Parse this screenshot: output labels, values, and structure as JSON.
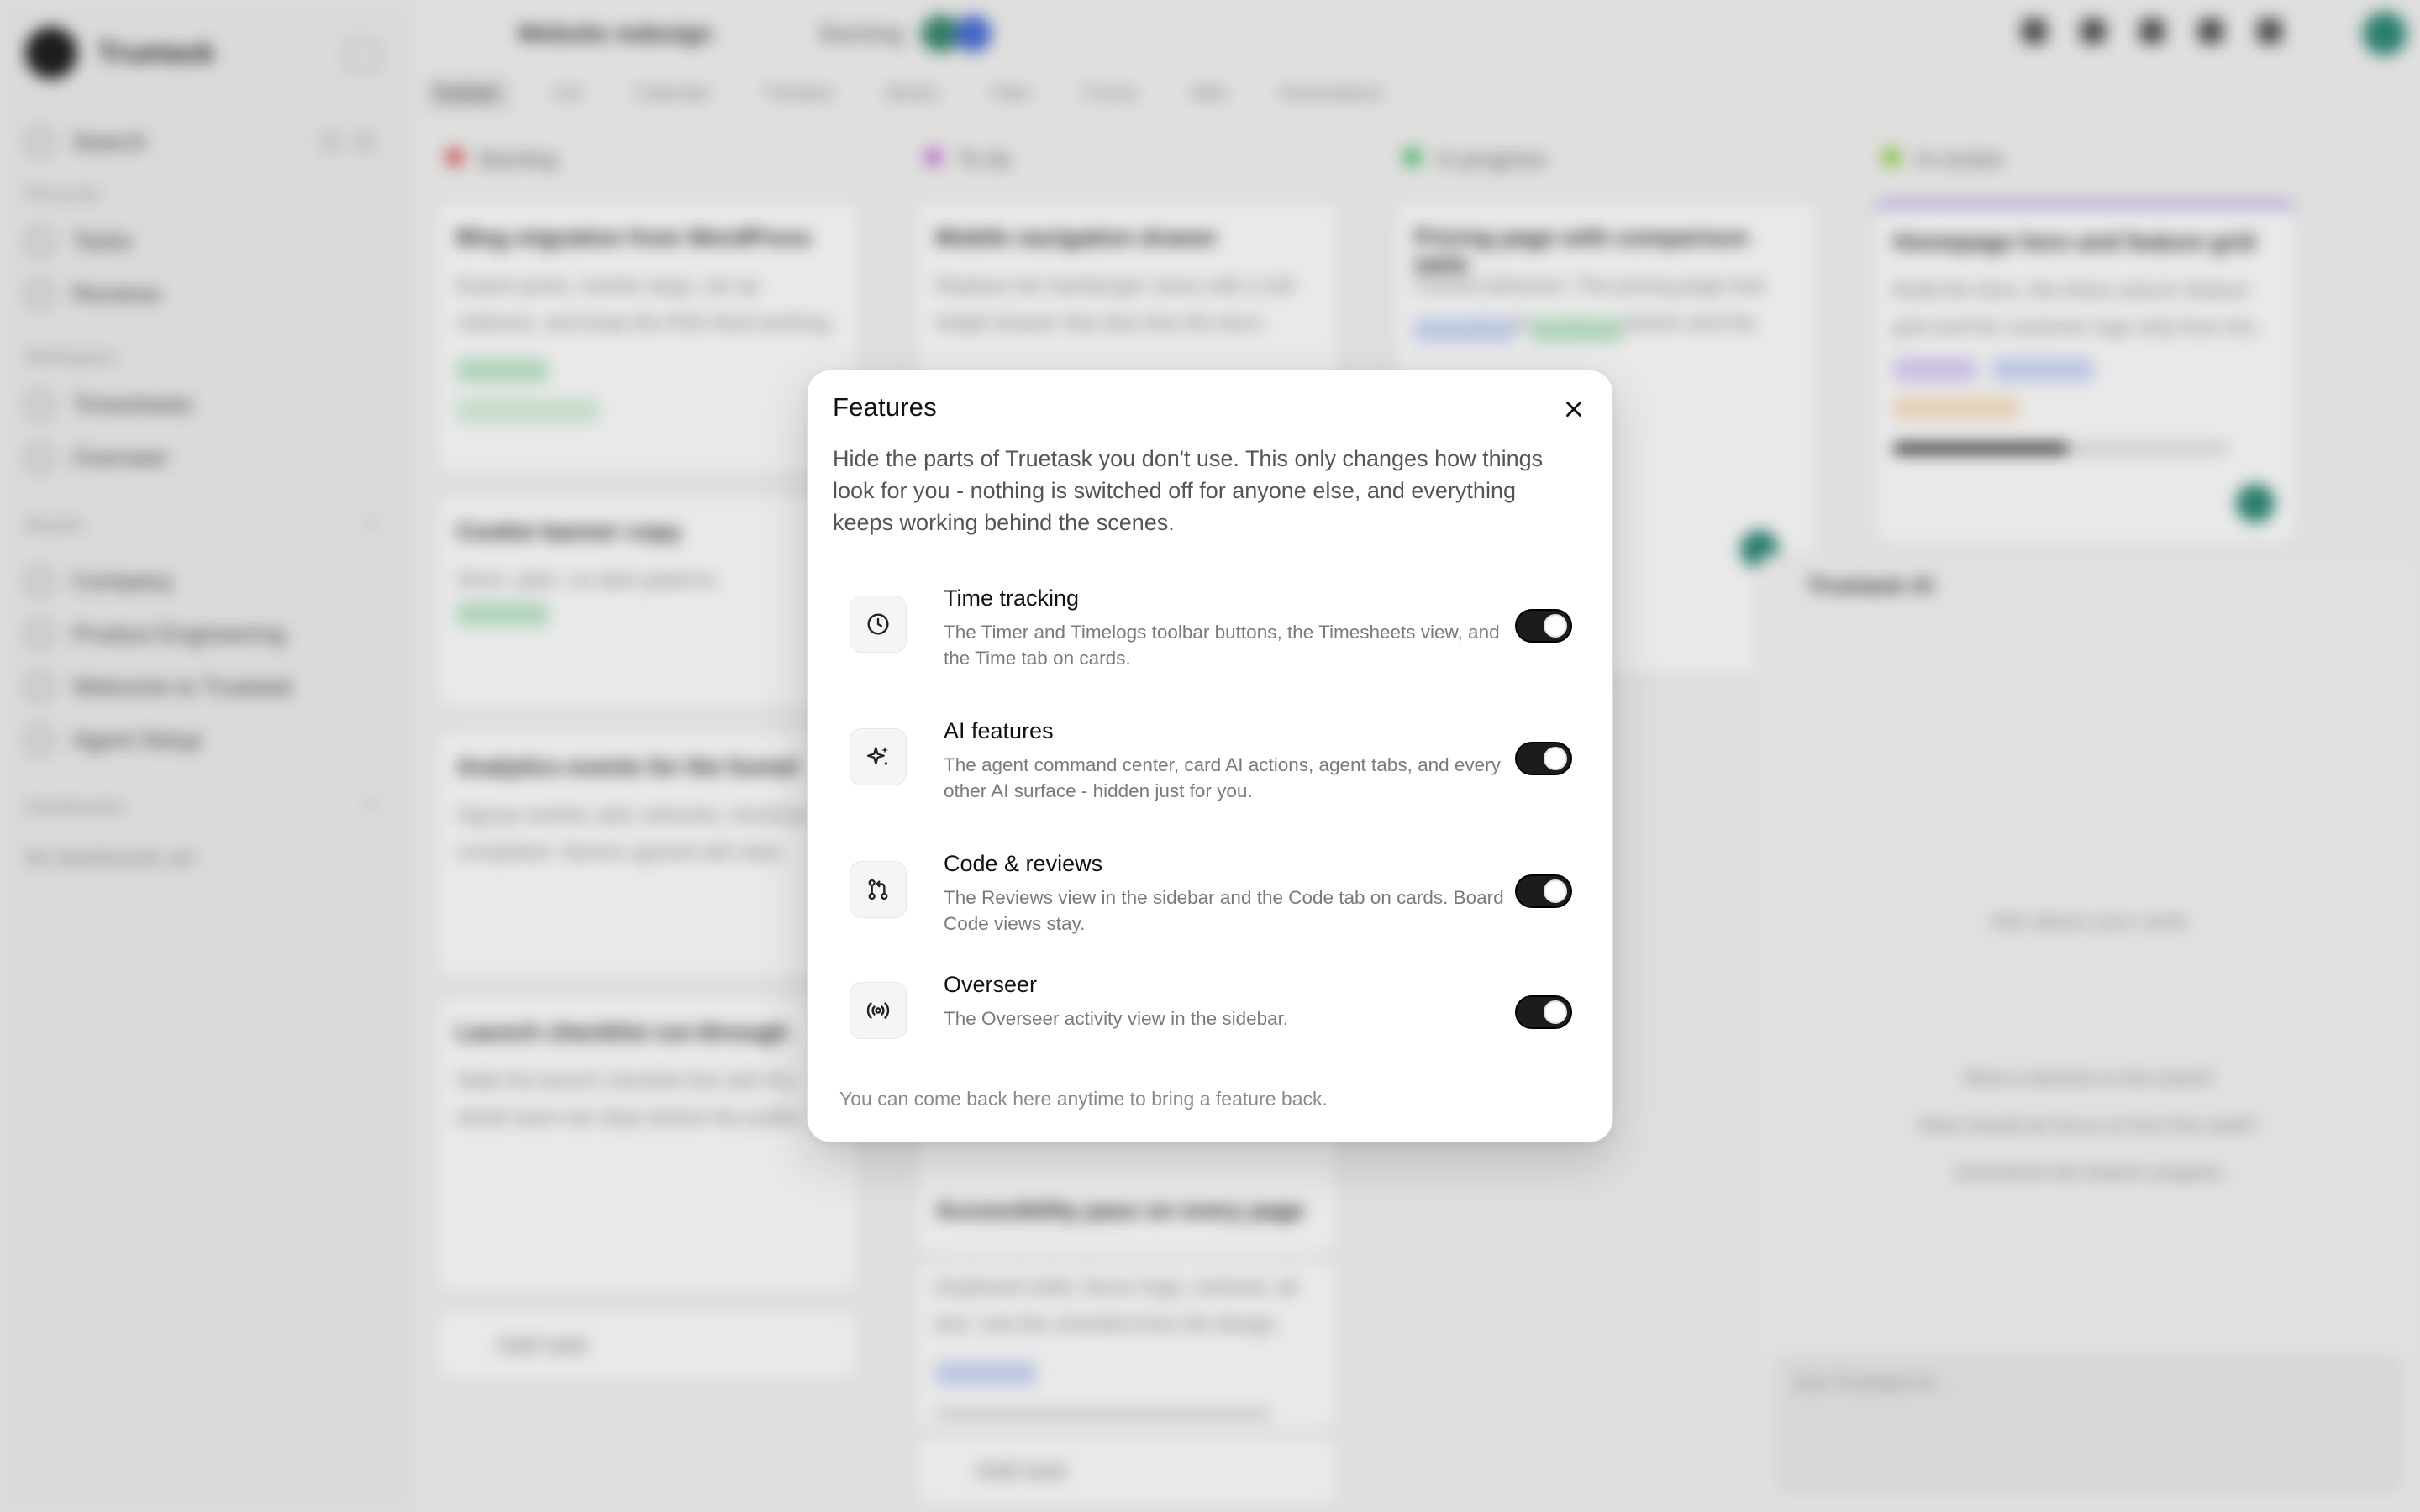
{
  "modal": {
    "title": "Features",
    "description": "Hide the parts of Truetask you don't use. This only changes how things look for you - nothing is switched off for anyone else, and everything keeps working behind the scenes.",
    "footer": "You can come back here anytime to bring a feature back.",
    "features": [
      {
        "name": "Time tracking",
        "description": "The Timer and Timelogs toolbar buttons, the Timesheets view, and the Time tab on cards.",
        "icon": "clock-icon",
        "enabled": true
      },
      {
        "name": "AI features",
        "description": "The agent command center, card AI actions, agent tabs, and every other AI surface - hidden just for you.",
        "icon": "sparkle-icon",
        "enabled": true
      },
      {
        "name": "Code & reviews",
        "description": "The Reviews view in the sidebar and the Code tab on cards. Board Code views stay.",
        "icon": "git-pull-request-icon",
        "enabled": true
      },
      {
        "name": "Overseer",
        "description": "The Overseer activity view in the sidebar.",
        "icon": "broadcast-icon",
        "enabled": true
      }
    ]
  },
  "background": {
    "brand": "Truetask",
    "sidebar": {
      "search": "Search",
      "personal_heading": "Personal",
      "personal_items": [
        "Tasks",
        "Reviews"
      ],
      "workspace_heading": "Workspace",
      "workspace_items": [
        "Timesheets",
        "Overseer"
      ],
      "boards_heading": "Boards",
      "boards": [
        "Company",
        "Product Engineering",
        "Welcome to Truetask",
        "Agent Setup"
      ],
      "dashboards_heading": "Dashboards",
      "dashboards_empty": "No dashboards yet"
    },
    "breadcrumb": {
      "board": "Website redesign",
      "column": "Backlog"
    },
    "view_tabs": [
      "Kanban",
      "List",
      "Calendar",
      "Timeline",
      "Books",
      "Files",
      "Forms",
      "Wiki",
      "Automations"
    ],
    "columns": [
      {
        "name": "Backlog",
        "color": "#e05a5a",
        "cards": [
          {
            "title": "Blog migration from WordPress",
            "desc": "Export posts, rewrite slugs, set up redirects, and keep the RSS feed working."
          },
          {
            "title": "Cookie banner copy",
            "desc": "Short, plain, no dark patterns."
          },
          {
            "title": "Analytics events for the funnel",
            "desc": "Signup started, plan selected, checkout completed. Names agreed with data."
          },
          {
            "title": "Launch checklist run-through",
            "desc": "Walk the launch checklist line with the whole team two days before the public."
          }
        ],
        "add": "Add task"
      },
      {
        "name": "To do",
        "color": "#c876d8",
        "cards": [
          {
            "title": "Mobile navigation drawer",
            "desc": "Replace the hamburger menu with a full-height drawer that also lists the docs."
          },
          {
            "title": "Accessibility pass on every page",
            "desc": "Keyboard order, focus rings, contrast, alt text. Use the checklist from the design."
          }
        ],
        "add": "Add task"
      },
      {
        "name": "In progress",
        "color": "#4fbf6b",
        "cards": [
          {
            "title": "Pricing page with comparison table",
            "desc": "Current behavior: The pricing page lists every plan in one long column and the."
          }
        ]
      },
      {
        "name": "In review",
        "color": "#8fcf3a",
        "cards": [
          {
            "title": "Homepage hero and feature grid",
            "desc": "Build the hero, the three-column feature grid and the customer logo strip from the."
          }
        ]
      }
    ],
    "chat": {
      "title": "Truetask AI",
      "prompt": "Ask about your work",
      "suggestions": [
        "What is blocked on this board?",
        "What should we focus on from this week?",
        "Summarize this board's progress"
      ],
      "input_placeholder": "Ask Truetask AI..."
    }
  }
}
